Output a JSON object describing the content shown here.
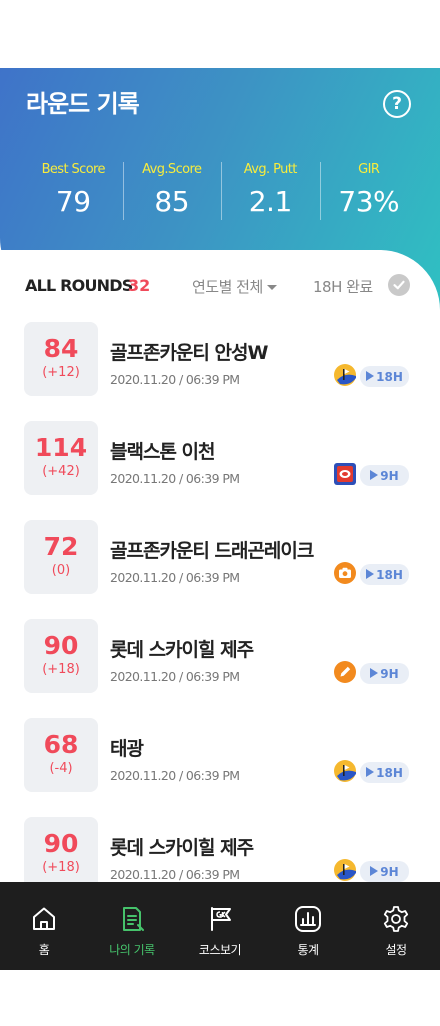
{
  "header": {
    "title": "라운드 기록",
    "help": "?",
    "stats": [
      {
        "label": "Best Score",
        "value": "79"
      },
      {
        "label": "Avg.Score",
        "value": "85"
      },
      {
        "label": "Avg. Putt",
        "value": "2.1"
      },
      {
        "label": "GIR",
        "value": "73%"
      }
    ]
  },
  "filters": {
    "all_rounds_label": "ALL ROUNDS",
    "all_rounds_count": "32",
    "year_filter": "연도별 전체",
    "complete_filter": "18H 완료"
  },
  "rounds": [
    {
      "score": "84",
      "diff": "(+12)",
      "course": "골프존카운티 안성W",
      "date": "2020.11.20 / 06:39 PM",
      "source_icon": "flag-logo-icon",
      "holes": "18H"
    },
    {
      "score": "114",
      "diff": "(+42)",
      "course": "블랙스톤 이천",
      "date": "2020.11.20 / 06:39 PM",
      "source_icon": "red-blue-logo-icon",
      "holes": "9H"
    },
    {
      "score": "72",
      "diff": "(0)",
      "course": "골프존카운티 드래곤레이크",
      "date": "2020.11.20 / 06:39 PM",
      "source_icon": "camera-icon",
      "holes": "18H"
    },
    {
      "score": "90",
      "diff": "(+18)",
      "course": "롯데 스카이힐 제주",
      "date": "2020.11.20 / 06:39 PM",
      "source_icon": "pencil-icon",
      "holes": "9H"
    },
    {
      "score": "68",
      "diff": "(-4)",
      "course": "태광",
      "date": "2020.11.20 / 06:39 PM",
      "source_icon": "flag-logo-icon",
      "holes": "18H"
    },
    {
      "score": "90",
      "diff": "(+18)",
      "course": "롯데 스카이힐 제주",
      "date": "2020.11.20 / 06:39 PM",
      "source_icon": "flag-logo-icon",
      "holes": "9H"
    }
  ],
  "nav": [
    {
      "label": "홈",
      "icon": "home-icon"
    },
    {
      "label": "나의 기록",
      "icon": "record-icon"
    },
    {
      "label": "코스보기",
      "icon": "course-flag-icon"
    },
    {
      "label": "통계",
      "icon": "stats-icon"
    },
    {
      "label": "설정",
      "icon": "gear-icon"
    }
  ],
  "colors": {
    "accent_red": "#f04a5a",
    "stat_label_yellow": "#f7ec3d",
    "nav_active_green": "#46c36b",
    "nav_background": "#1e1e1e"
  }
}
